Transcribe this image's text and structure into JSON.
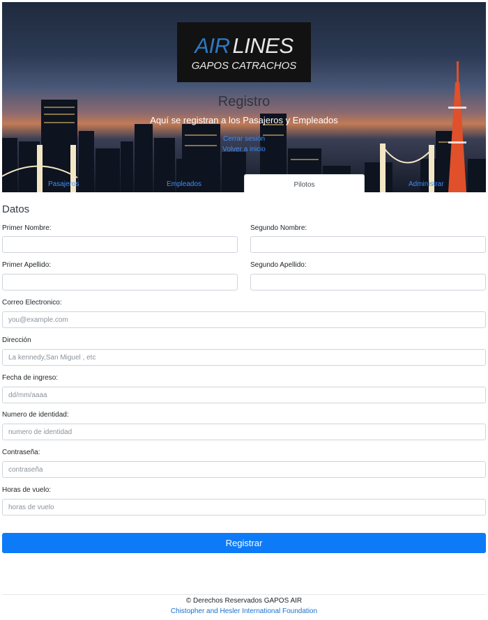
{
  "brand": {
    "logo_word1": "AIR",
    "logo_word2": "LINES",
    "logo_tagline": "GAPOS CATRACHOS"
  },
  "hero": {
    "title": "Registro",
    "subtitle": "Aquí se registran a los Pasajeros y Empleados",
    "logout_link": "Cerrar sesión",
    "home_link": "Volver a inicio"
  },
  "tabs": [
    {
      "label": "Pasajeros",
      "active": false
    },
    {
      "label": "Empleados",
      "active": false
    },
    {
      "label": "Pilotos",
      "active": true
    },
    {
      "label": "Administrar",
      "active": false
    }
  ],
  "form": {
    "section_title": "Datos",
    "first_name": {
      "label": "Primer Nombre:",
      "value": "",
      "placeholder": ""
    },
    "second_name": {
      "label": "Segundo Nombre:",
      "value": "",
      "placeholder": ""
    },
    "first_lastname": {
      "label": "Primer Apellido:",
      "value": "",
      "placeholder": ""
    },
    "second_lastname": {
      "label": "Segundo Apellido:",
      "value": "",
      "placeholder": ""
    },
    "email": {
      "label": "Correo Electronico:",
      "value": "",
      "placeholder": "you@example.com"
    },
    "address": {
      "label": "Dirección",
      "value": "",
      "placeholder": "La kennedy,San Miguel , etc"
    },
    "start_date": {
      "label": "Fecha de ingreso:",
      "value": "",
      "placeholder": "dd/mm/aaaa"
    },
    "id_number": {
      "label": "Numero de identidad:",
      "value": "",
      "placeholder": "numero de identidad"
    },
    "password": {
      "label": "Contraseña:",
      "value": "",
      "placeholder": "contraseña"
    },
    "flight_hours": {
      "label": "Horas de vuelo:",
      "value": "",
      "placeholder": "horas de vuelo"
    },
    "submit_label": "Registrar"
  },
  "footer": {
    "copyright": "© Derechos Reservados GAPOS AIR",
    "credit": "Chistopher and Hesler International Foundation"
  },
  "colors": {
    "primary": "#0d7bf7",
    "link": "#3f8ef5",
    "logo_accent": "#2f78c4"
  }
}
